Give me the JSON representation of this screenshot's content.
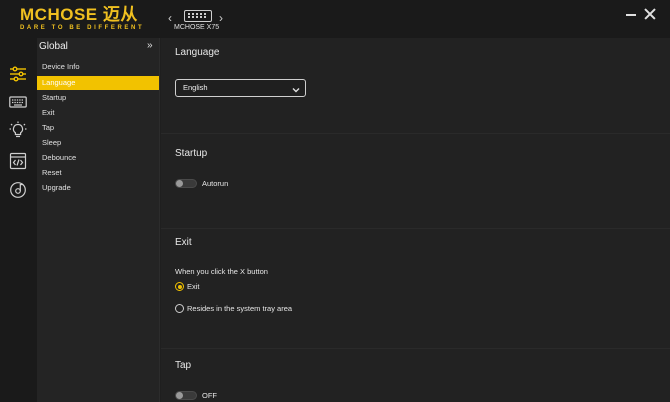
{
  "titlebar": {
    "logo_text": "MCHOSE 迈从",
    "logo_tagline": "DARE TO BE DIFFERENT",
    "device_name": "MCHOSE X75"
  },
  "rail": {
    "icons": [
      "sliders-icon",
      "keyboard-icon",
      "bulb-icon",
      "code-icon",
      "disc-icon"
    ]
  },
  "submenu": {
    "header": "Global",
    "items": [
      "Device Info",
      "Language",
      "Startup",
      "Exit",
      "Tap",
      "Sleep",
      "Debounce",
      "Reset",
      "Upgrade"
    ],
    "active_index": 1
  },
  "language": {
    "title": "Language",
    "selected": "English"
  },
  "startup": {
    "title": "Startup",
    "autorun_label": "Autorun",
    "autorun_on": false
  },
  "exit": {
    "title": "Exit",
    "prompt": "When you click the X button",
    "options": [
      "Exit",
      "Resides in the system tray area"
    ],
    "selected_index": 0
  },
  "tap": {
    "title": "Tap",
    "state_label": "OFF",
    "on": false
  },
  "colors": {
    "accent": "#f2c200",
    "background": "#222222"
  }
}
